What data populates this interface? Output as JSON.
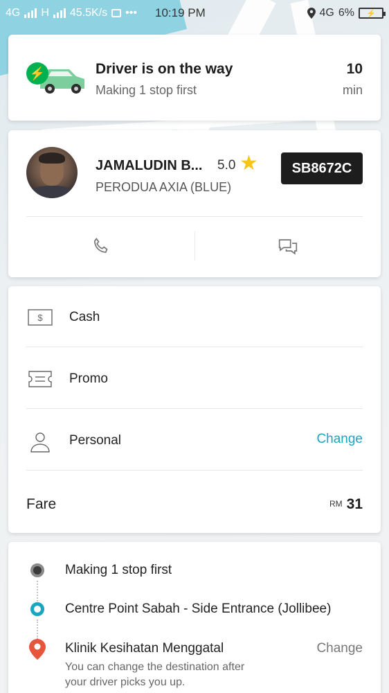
{
  "status_bar": {
    "network_left": "4G",
    "network_mid": "H",
    "speed": "45.5K/s",
    "dots": "•••",
    "time": "10:19 PM",
    "network_right": "4G",
    "battery": "6%"
  },
  "trip_status": {
    "title": "Driver is on the way",
    "subtitle": "Making 1 stop first",
    "eta_value": "10",
    "eta_unit": "min"
  },
  "driver": {
    "name": "JAMALUDIN B...",
    "rating": "5.0",
    "vehicle": "PERODUA AXIA (BLUE)",
    "plate": "SB8672C"
  },
  "payment": {
    "method": "Cash",
    "promo": "Promo",
    "profile": "Personal",
    "profile_action": "Change",
    "fare_label": "Fare",
    "fare_currency": "RM",
    "fare_amount": "31"
  },
  "route": {
    "stop_1": "Making 1 stop first",
    "stop_2": "Centre Point Sabah - Side Entrance (Jollibee)",
    "destination": "Klinik Kesihatan Menggatal",
    "destination_action": "Change",
    "note_line_1": "You can change the destination after",
    "note_line_2": "your driver picks you up."
  },
  "colors": {
    "brand_green": "#00b14f",
    "accent_teal": "#1aa6c0",
    "star": "#f5c518",
    "pin_red": "#e8553d"
  }
}
